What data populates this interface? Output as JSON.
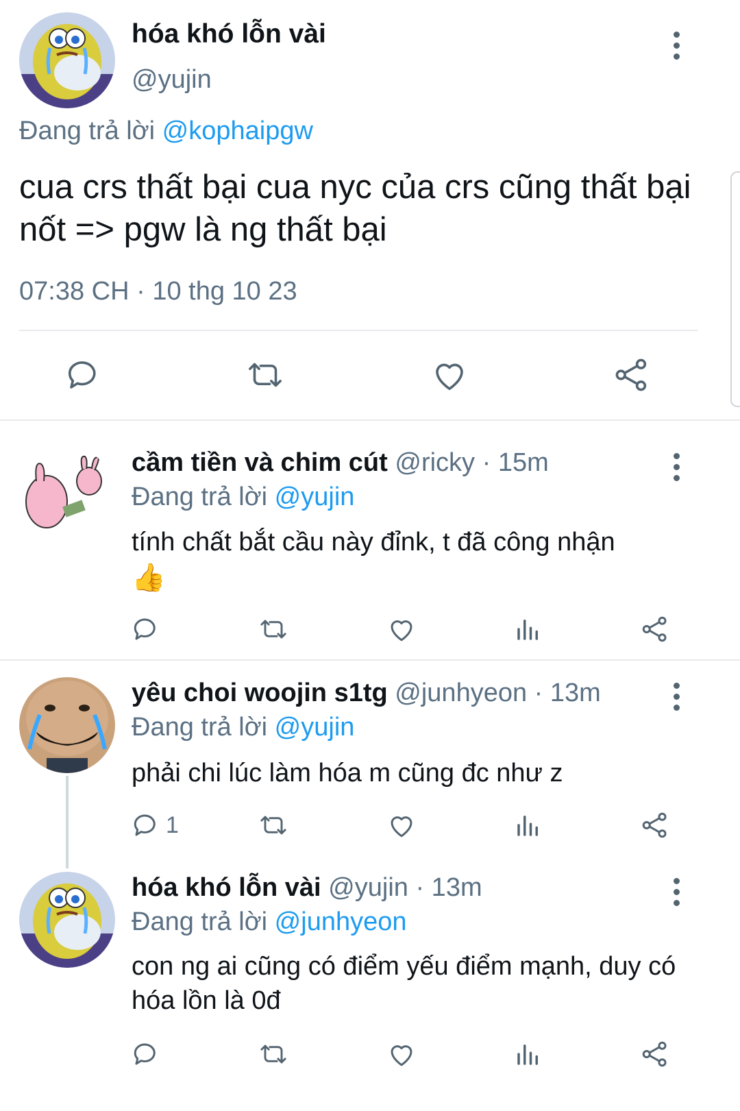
{
  "main_tweet": {
    "display_name": "hóa khó lỗn vài",
    "handle": "@yujin",
    "replying_prefix": "Đang trả lời",
    "replying_to": "@kophaipgw",
    "text": "cua crs thất bại cua nyc của crs cũng thất bại nốt => pgw là ng thất bại",
    "time": "07:38 CH",
    "dot": "·",
    "date": "10 thg 10 23"
  },
  "replies": [
    {
      "display_name": "cầm tiền và chim cút",
      "handle": "@ricky",
      "age": "· 15m",
      "replying_prefix": "Đang trả lời",
      "replying_to": "@yujin",
      "text": "tính chất bắt cầu này đỉnk, t đã công nhận",
      "emoji": "👍",
      "reply_count": ""
    },
    {
      "display_name": "yêu choi woojin s1tg",
      "handle": "@junhyeon",
      "age": "· 13m",
      "replying_prefix": "Đang trả lời",
      "replying_to": "@yujin",
      "text": "phải chi lúc làm hóa m cũng đc như z",
      "reply_count": "1"
    },
    {
      "display_name": "hóa khó lỗn vài",
      "handle": "@yujin",
      "age": "· 13m",
      "replying_prefix": "Đang trả lời",
      "replying_to": "@junhyeon",
      "text": "con ng ai cũng có điểm yếu điểm mạnh, duy có hóa lồn là 0đ",
      "reply_count": ""
    }
  ],
  "icons": {
    "reply": "reply-icon",
    "retweet": "retweet-icon",
    "like": "heart-icon",
    "views": "views-icon",
    "share": "share-icon",
    "more": "more-vertical-icon"
  },
  "colors": {
    "link": "#1d9bf0",
    "secondary_text": "#5b7083",
    "icon": "#536471",
    "divider": "#e7e9ec"
  }
}
